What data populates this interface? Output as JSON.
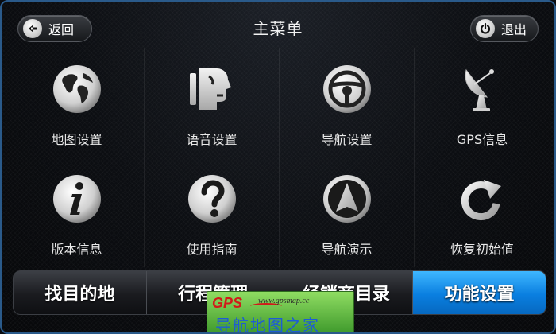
{
  "header": {
    "title": "主菜单",
    "back_label": "返回",
    "exit_label": "退出"
  },
  "menu": {
    "items": [
      {
        "label": "地图设置",
        "icon": "globe-icon"
      },
      {
        "label": "语音设置",
        "icon": "speaking-head-icon"
      },
      {
        "label": "导航设置",
        "icon": "steering-wheel-icon"
      },
      {
        "label": "GPS信息",
        "icon": "satellite-dish-icon"
      },
      {
        "label": "版本信息",
        "icon": "info-icon"
      },
      {
        "label": "使用指南",
        "icon": "question-icon"
      },
      {
        "label": "导航演示",
        "icon": "navigation-arrow-icon"
      },
      {
        "label": "恢复初始值",
        "icon": "refresh-icon"
      }
    ]
  },
  "tabs": [
    {
      "label": "找目的地",
      "active": false
    },
    {
      "label": "行程管理",
      "active": false
    },
    {
      "label": "经销商目录",
      "active": false
    },
    {
      "label": "功能设置",
      "active": true
    }
  ],
  "watermark": {
    "logo": "GPS",
    "url": "www.gpsmap.cc",
    "text": "导航地图之家"
  },
  "colors": {
    "active_tab": "#0a7fe0",
    "frame_border": "#2a5a8a",
    "watermark_bg": "#6cc24a",
    "watermark_text": "#1d5bd6"
  }
}
